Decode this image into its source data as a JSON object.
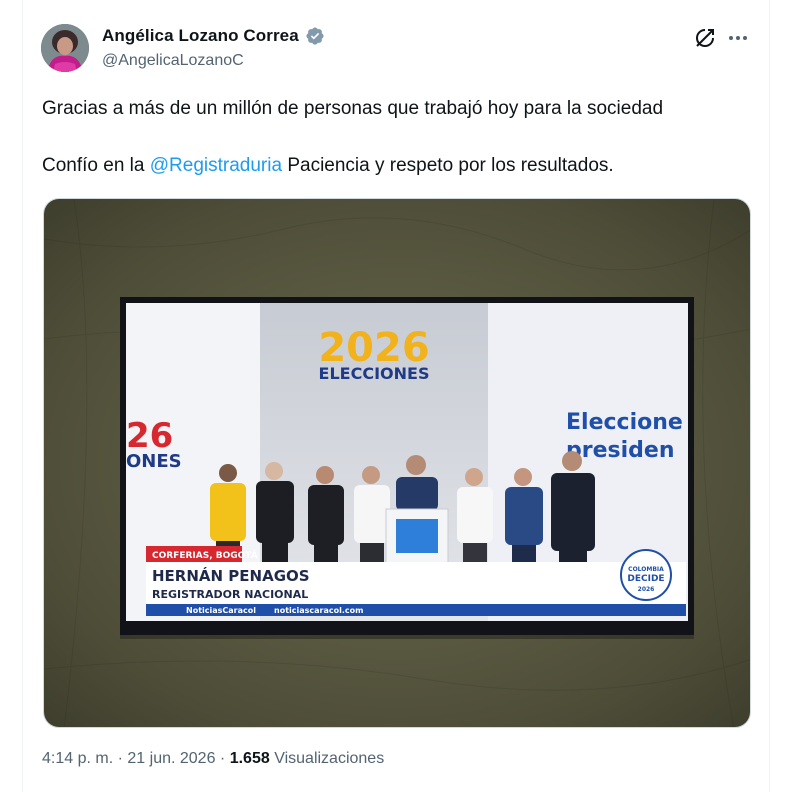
{
  "author": {
    "name": "Angélica Lozano Correa",
    "handle": "@AngelicaLozanoC",
    "verified_color": "#829aab"
  },
  "actions": {
    "grok_icon": "grok-icon",
    "more_icon": "more-dots-icon"
  },
  "tweet": {
    "line1": "Gracias a más de un millón de personas que trabajó hoy para la sociedad",
    "line2_before": "Confío en la ",
    "mention": "@Registraduria",
    "line2_after": " Paciencia y respeto por los resultados."
  },
  "media": {
    "logo_year": "2026",
    "logo_word": "ELECCIONES",
    "left_logo_year": "26",
    "left_logo_word": "ONES",
    "right_text_line1": "Eleccione",
    "right_text_line2": "presiden",
    "location_tag": "CORFERIAS, BOGOTÁ",
    "lower_third_name": "HERNÁN PENAGOS",
    "lower_third_title": "REGISTRADOR NACIONAL",
    "ticker_brand": "NoticiasCaracol",
    "ticker_url": "noticiascaracol.com",
    "badge_line1": "COLOMBIA",
    "badge_line2": "DECIDE",
    "badge_year": "2026"
  },
  "meta": {
    "time": "4:14 p. m.",
    "separator": "·",
    "date": "21 jun. 2026",
    "views_count": "1.658",
    "views_label": "Visualizaciones"
  }
}
